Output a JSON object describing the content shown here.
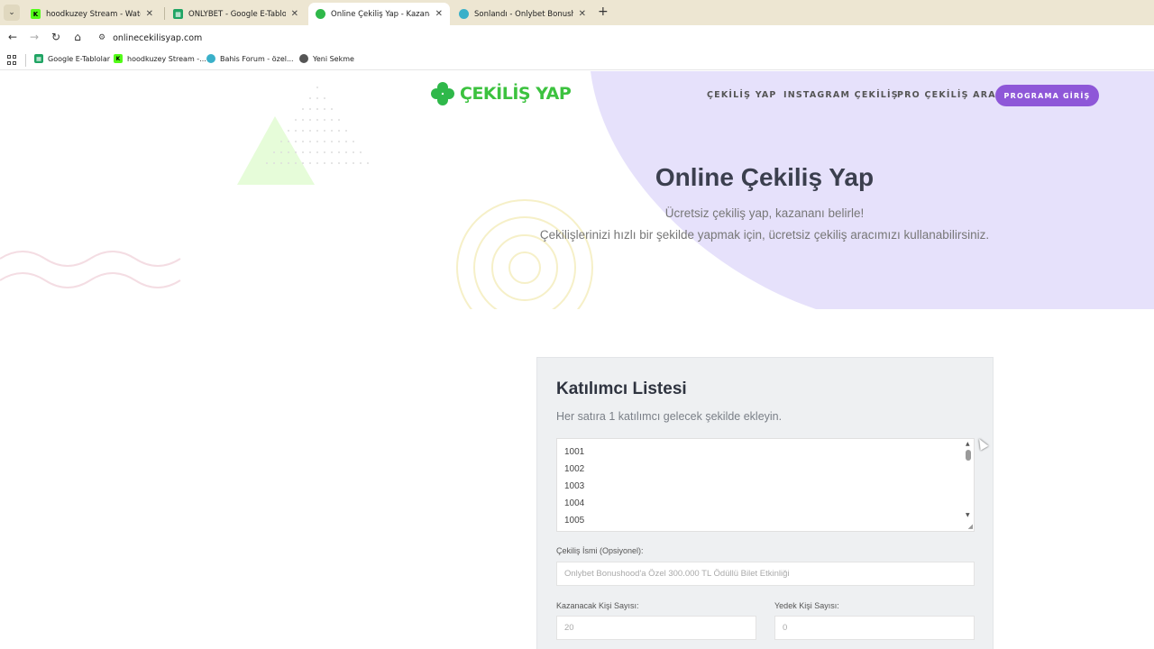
{
  "browser": {
    "tabs": [
      {
        "title": "hoodkuzey Stream - Watch Live",
        "favicon": "kick-icon",
        "active": false
      },
      {
        "title": "ONLYBET - Google E-Tablolar",
        "favicon": "sheets-icon",
        "active": false
      },
      {
        "title": "Online Çekiliş Yap - Kazananı Be",
        "favicon": "clover-icon",
        "active": true
      },
      {
        "title": "Sonlandı - Onlybet Bonushood",
        "favicon": "bird-icon",
        "active": false
      }
    ],
    "url": "onlinecekilisyap.com",
    "bookmarks": [
      {
        "label": "Google E-Tablolar"
      },
      {
        "label": "hoodkuzey Stream -..."
      },
      {
        "label": "Bahis Forum - özel..."
      },
      {
        "label": "Yeni Sekme"
      }
    ]
  },
  "site": {
    "logo_text": "ÇEKİLİŞ YAP",
    "nav": [
      "ÇEKİLİŞ YAP",
      "INSTAGRAM ÇEKİLİŞ",
      "PRO ÇEKİLİŞ ARACI"
    ],
    "cta": "PROGRAMA GİRİŞ",
    "hero": {
      "title": "Online Çekiliş Yap",
      "subtitle1": "Ücretsiz çekiliş yap, kazananı belirle!",
      "subtitle2": "Çekilişlerinizi hızlı bir şekilde yapmak için, ücretsiz çekiliş aracımızı kullanabilirsiniz."
    },
    "form": {
      "title": "Katılımcı Listesi",
      "description": "Her satıra 1 katılımcı gelecek şekilde ekleyin.",
      "participants": [
        "1001",
        "1002",
        "1003",
        "1004",
        "1005"
      ],
      "name_label": "Çekiliş İsmi (Opsiyonel):",
      "name_value": "Onlybet Bonushood'a Özel 300.000 TL Ödüllü Bilet Etkinliği",
      "winners_label": "Kazanacak Kişi Sayısı:",
      "winners_value": "20",
      "backup_label": "Yedek Kişi Sayısı:",
      "backup_value": "0"
    },
    "colors": {
      "accent": "#8e57d8",
      "logo_green": "#3cc23f",
      "hero_bg": "#e6e1fb"
    }
  }
}
